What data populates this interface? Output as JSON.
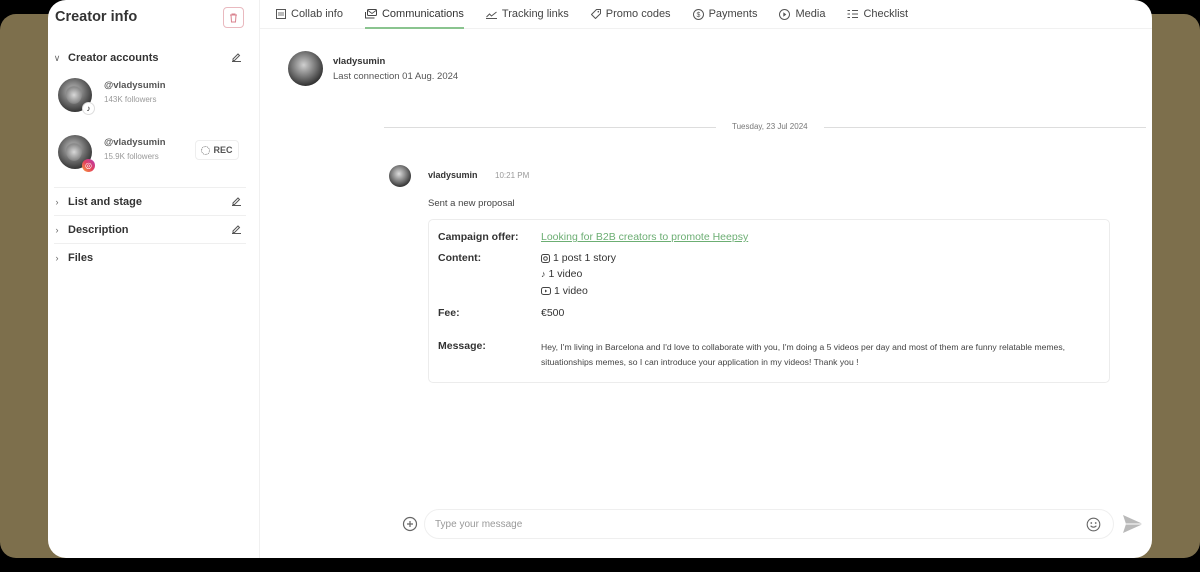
{
  "sidebar": {
    "title": "Creator info",
    "sections": {
      "creator_accounts": "Creator accounts",
      "list_and_stage": "List and stage",
      "description": "Description",
      "files": "Files"
    },
    "accounts": [
      {
        "platform": "tiktok",
        "handle": "@vladysumin",
        "followers": "143K followers",
        "badge_icon": "♪"
      },
      {
        "platform": "instagram",
        "handle": "@vladysumin",
        "followers": "15.9K followers",
        "badge_icon": "◎",
        "rec_label": "REC"
      }
    ]
  },
  "tabs": [
    {
      "label": "Collab info",
      "icon": "collab-info-icon",
      "active": false
    },
    {
      "label": "Communications",
      "icon": "communications-icon",
      "active": true
    },
    {
      "label": "Tracking links",
      "icon": "tracking-links-icon",
      "active": false
    },
    {
      "label": "Promo codes",
      "icon": "tag-icon",
      "active": false
    },
    {
      "label": "Payments",
      "icon": "dollar-icon",
      "active": false
    },
    {
      "label": "Media",
      "icon": "play-icon",
      "active": false
    },
    {
      "label": "Checklist",
      "icon": "checklist-icon",
      "active": false
    }
  ],
  "contact": {
    "name": "vladysumin",
    "last_connection": "Last connection 01 Aug. 2024"
  },
  "conversation": {
    "date_separator": "Tuesday, 23 Jul 2024",
    "message": {
      "author": "vladysumin",
      "time": "10:21 PM",
      "text": "Sent a new proposal",
      "proposal": {
        "campaign_label": "Campaign offer:",
        "campaign_value": "Looking for B2B creators to promote Heepsy",
        "content_label": "Content:",
        "content_items": [
          {
            "platform": "instagram",
            "text": "1 post  1 story"
          },
          {
            "platform": "tiktok",
            "text": "1 video"
          },
          {
            "platform": "youtube",
            "text": "1 video"
          }
        ],
        "fee_label": "Fee:",
        "fee_value": "€500",
        "message_label": "Message:",
        "message_value": "Hey, I'm living in Barcelona and I'd love to collaborate with you, I'm doing a 5 videos per day and most of them are funny relatable memes, situationships memes, so I can introduce your application in my videos! Thank you !"
      }
    }
  },
  "composer": {
    "placeholder": "Type your message",
    "value": ""
  },
  "colors": {
    "accent_green": "#8ac48f",
    "link_green": "#6cae73",
    "delete_border": "#e9b9bf",
    "backdrop": "#7d6f4c"
  }
}
